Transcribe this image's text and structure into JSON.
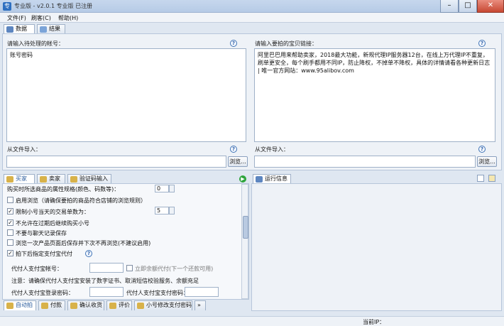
{
  "window": {
    "title": "专业版 - v2.0.1 专业版 已注册",
    "min": "–",
    "max": "□",
    "close": "✕"
  },
  "menu": [
    {
      "label": "文件(F)"
    },
    {
      "label": "刷客(C)"
    },
    {
      "label": "帮助(H)"
    }
  ],
  "main_tabs": [
    {
      "label": "数据"
    },
    {
      "label": "结果"
    }
  ],
  "left_input": {
    "label": "请输入待处理的帐号：",
    "text": "账号密码",
    "import_label": "从文件导入：",
    "browse": "浏览..."
  },
  "right_input": {
    "label": "请输入要拍的宝贝链接：",
    "text": "阿里巴巴用来帮助卖家，2018最大功能，新规代理IP服务器12台，在线上万代理IP不重复，刷单更安全，每个刷手都用不同IP，防止降权，不掉单不降权，具体的详情请看各种更新日志 | 唯一官方网站：www.95alibov.com",
    "import_label": "从文件导入：",
    "browse": "浏览..."
  },
  "settings_tabs": [
    {
      "label": "买家"
    },
    {
      "label": "卖家"
    },
    {
      "label": "验证码输入"
    }
  ],
  "settings": {
    "top_row_label": "购买时所选商品的属性规格(颜色、码数等)：",
    "top_row_value": "0",
    "row1": "启用浏览（请确保要拍的商品符合店铺的浏览规则）",
    "row2": "限制小号当天的交易单数为：",
    "row2_value": "5",
    "row3": "不允许在过期后继续购买小号",
    "row4": "不要与聊天记录保存",
    "row5": "浏览一次产品页面后保存并下次不再浏览(不建议启用)",
    "row6": "拍下后指定支付宝代付",
    "payer_label": "代付人支付宝帐号：",
    "payer_check": "立即余额代付(下一个还款可用)",
    "note": "注意：请确保代付人支付宝安装了数字证书、取消短信校验服务、余额充足",
    "login_pwd_label": "代付人支付宝登录密码：",
    "pay_pwd_label": "代付人支付宝支付密码："
  },
  "bottom_tabs": [
    {
      "label": "自动拍"
    },
    {
      "label": "付款"
    },
    {
      "label": "确认收货"
    },
    {
      "label": "评价"
    },
    {
      "label": "小号修改支付密码"
    },
    {
      "label": "»"
    }
  ],
  "log": {
    "title": "运行信息"
  },
  "status": {
    "ip_label": "当前IP："
  }
}
